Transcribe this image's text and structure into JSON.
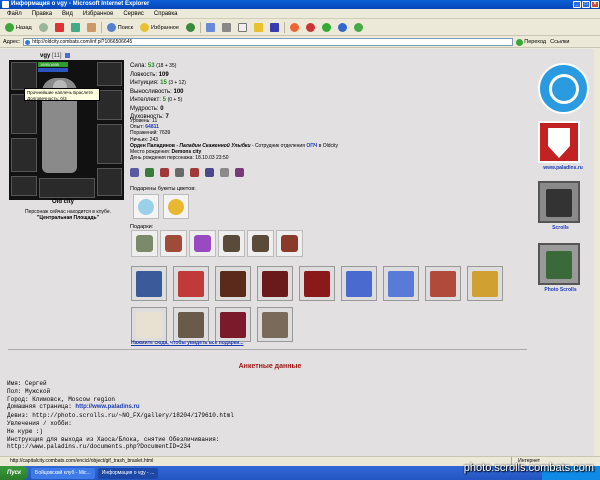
{
  "window": {
    "title": "Информация о vgy - Microsoft Internet Explorer"
  },
  "menu": [
    "Файл",
    "Правка",
    "Вид",
    "Избранное",
    "Сервис",
    "Справка"
  ],
  "toolbar": {
    "back": "Назад",
    "search": "Поиск",
    "favorites": "Избранное"
  },
  "address": {
    "label": "Адрес:",
    "url": "http://oldcity.combats.com/inf.pl?1066506645",
    "go": "Переход",
    "links": "Ссылки"
  },
  "character": {
    "name": "vgy",
    "level": "[11]",
    "hp": "1695/1695",
    "tooltip_line1": "Прочнейшие наплечь Браслете",
    "tooltip_line2": "Долговечность: 0/3",
    "city": "Old city",
    "location_line1": "Персонаж сейчас находится в клубе.",
    "location_line2": "\"Центральная Площадь\""
  },
  "stats": [
    {
      "label": "Сила:",
      "value": "53",
      "extra": "(18 + 35)"
    },
    {
      "label": "Ловкость:",
      "value": "109",
      "extra": ""
    },
    {
      "label": "Интуиция:",
      "value": "15",
      "extra": "(3 + 12)"
    },
    {
      "label": "Выносливость:",
      "value": "100",
      "extra": ""
    },
    {
      "label": "Интеллект:",
      "value": "5",
      "extra": "(0 + 5)"
    },
    {
      "label": "Мудрость:",
      "value": "0",
      "extra": ""
    },
    {
      "label": "Духовность:",
      "value": "7",
      "extra": ""
    }
  ],
  "info": {
    "level": "Уровень: 11",
    "exp_label": "Опыт:",
    "exp_value": "64811",
    "losses": "Поражений: 7639",
    "draws": "Ничьих: 243",
    "order_label": "Орден Паладинов",
    "order_rank": "- Паладин Скаженной Улыбки",
    "order_rest": "- Сотрудник отделения",
    "order_dept": "ОПЧ",
    "order_city": "в Oldcity",
    "birthplace_label": "Место рождения:",
    "birthplace": "Demons city",
    "birthday": "День рождения персонажа: 18.10.03 23:50"
  },
  "flowers_label": "Подарены букеты цветов:",
  "gifts_label": "Подарки:",
  "more_gifts": "Нажмите сюда, чтобы увидеть все подарки...",
  "anketa_title": "Анкетные данные",
  "profile": {
    "name": "Имя: Сергей",
    "sex": "Пол: Мужской",
    "city": "Город: Климовск, Moscow region",
    "homepage_label": "Домашняя страница: ",
    "homepage": "http://www.paladins.ru",
    "motto": "Девиз: http://photo.scrolls.ru/~NO_FX/gallery/18204/179610.html",
    "hobbies1": "Увлечения / хобби:",
    "hobbies2": "Не курю :)",
    "blank": "",
    "chaos1": "Инструкция для выхода из Хаоса/Блока, снятие Обезличивания:",
    "chaos2": "http://www.paladins.ru/documents.php?DocumentID=234"
  },
  "sidebar": {
    "paladins_url": "www.paladins.ru",
    "scrolls": "Scrolls",
    "photo_scrolls": "Photo Scrolls"
  },
  "status": {
    "url": "http://capitalcity.combats.com/encicl/object/gif_trash_braslet.html",
    "zone": "Интернет"
  },
  "taskbar": {
    "start": "Пуск",
    "task1": "Бойцовский клуб - Mic...",
    "task2": "Информация о vgy - ..."
  },
  "watermark": "photo.scrolls.combats.com",
  "colors": {
    "title_blue": "#0a5ed6",
    "link_blue": "#1d3bb5",
    "header_red": "#a01818",
    "stat_green": "#1e8a1e"
  }
}
